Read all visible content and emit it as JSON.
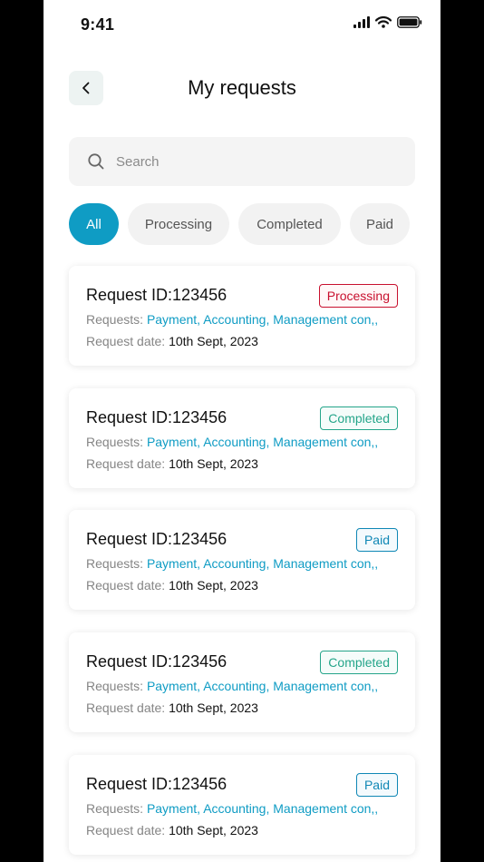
{
  "status_bar": {
    "time": "9:41"
  },
  "header": {
    "title": "My requests"
  },
  "search": {
    "placeholder": "Search"
  },
  "filters": [
    {
      "label": "All",
      "active": true
    },
    {
      "label": "Processing",
      "active": false
    },
    {
      "label": "Completed",
      "active": false
    },
    {
      "label": "Paid",
      "active": false
    }
  ],
  "labels": {
    "requests": "Requests:",
    "request_date": "Request date:"
  },
  "requests": [
    {
      "title": "Request ID:123456",
      "status": "Processing",
      "services": "Payment, Accounting, Management con,,",
      "date": "10th Sept, 2023"
    },
    {
      "title": "Request ID:123456",
      "status": "Completed",
      "services": "Payment, Accounting, Management con,,",
      "date": "10th Sept, 2023"
    },
    {
      "title": "Request ID:123456",
      "status": "Paid",
      "services": "Payment, Accounting, Management con,,",
      "date": "10th Sept, 2023"
    },
    {
      "title": "Request ID:123456",
      "status": "Completed",
      "services": "Payment, Accounting, Management con,,",
      "date": "10th Sept, 2023"
    },
    {
      "title": "Request ID:123456",
      "status": "Paid",
      "services": "Payment, Accounting, Management con,,",
      "date": "10th Sept, 2023"
    }
  ],
  "colors": {
    "accent": "#0f9cc4",
    "processing": "#c8102e",
    "completed": "#25a58a",
    "paid": "#0f87b5"
  },
  "icons": [
    "signal-icon",
    "wifi-icon",
    "battery-icon",
    "chevron-left-icon",
    "search-icon"
  ]
}
